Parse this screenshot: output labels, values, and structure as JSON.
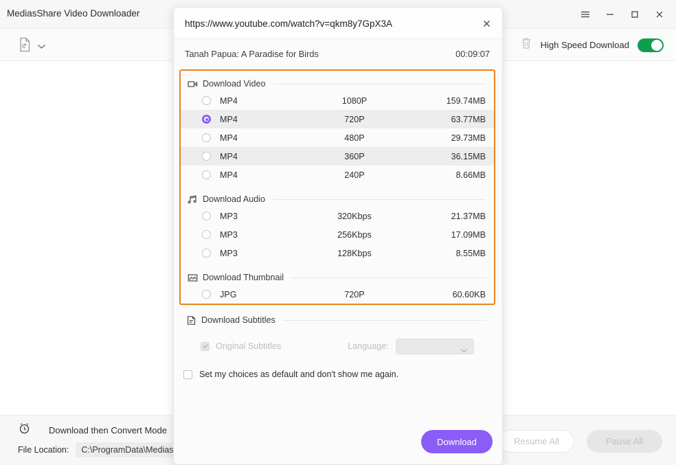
{
  "window": {
    "title": "MediasShare Video Downloader",
    "controls": [
      {
        "name": "menu",
        "label": "☰"
      },
      {
        "name": "minimize",
        "label": "–"
      },
      {
        "name": "maximize",
        "label": "□"
      },
      {
        "name": "close",
        "label": "✕"
      }
    ]
  },
  "toolbar": {
    "add_file_icon": "file-add-icon",
    "dropdown_caret": "chevron-down-icon",
    "trash_icon": "trash-icon",
    "high_speed_label": "High Speed Download",
    "high_speed_enabled": true,
    "accent_green": "#0f9e4e"
  },
  "footer": {
    "convert_mode_label": "Download then Convert Mode",
    "convert_mode_enabled": false,
    "clock_icon": "alarm-clock-icon",
    "file_location_label": "File Location:",
    "file_location_value": "C:\\ProgramData\\MediasS",
    "resume_all_label": "Resume All",
    "pause_all_label": "Pause All"
  },
  "dialog": {
    "url": "https://www.youtube.com/watch?v=qkm8y7GpX3A",
    "close_icon": "close-icon",
    "video_title": "Tanah Papua:  A Paradise for Birds",
    "duration": "00:09:07",
    "highlight_color": "#e8841c",
    "accent_purple": "#8b5cf6",
    "sections": [
      {
        "name": "download-video",
        "icon": "video-camera-icon",
        "title": "Download Video",
        "options": [
          {
            "format": "MP4",
            "quality": "1080P",
            "size": "159.74MB",
            "selected": false,
            "shaded": false
          },
          {
            "format": "MP4",
            "quality": "720P",
            "size": "63.77MB",
            "selected": true,
            "shaded": true
          },
          {
            "format": "MP4",
            "quality": "480P",
            "size": "29.73MB",
            "selected": false,
            "shaded": false
          },
          {
            "format": "MP4",
            "quality": "360P",
            "size": "36.15MB",
            "selected": false,
            "shaded": true
          },
          {
            "format": "MP4",
            "quality": "240P",
            "size": "8.66MB",
            "selected": false,
            "shaded": false
          }
        ]
      },
      {
        "name": "download-audio",
        "icon": "music-note-icon",
        "title": "Download Audio",
        "options": [
          {
            "format": "MP3",
            "quality": "320Kbps",
            "size": "21.37MB",
            "selected": false,
            "shaded": false
          },
          {
            "format": "MP3",
            "quality": "256Kbps",
            "size": "17.09MB",
            "selected": false,
            "shaded": false
          },
          {
            "format": "MP3",
            "quality": "128Kbps",
            "size": "8.55MB",
            "selected": false,
            "shaded": false
          }
        ]
      },
      {
        "name": "download-thumbnail",
        "icon": "image-icon",
        "title": "Download Thumbnail",
        "options": [
          {
            "format": "JPG",
            "quality": "720P",
            "size": "60.60KB",
            "selected": false,
            "shaded": false
          }
        ]
      }
    ],
    "subtitles": {
      "icon": "document-icon",
      "title": "Download Subtitles",
      "original_label": "Original Subtitles",
      "original_checked": true,
      "original_disabled": true,
      "language_label": "Language:",
      "language_value": "",
      "language_caret": "chevron-down-icon"
    },
    "default_checkbox": {
      "label": "Set my choices as default and don't show me again.",
      "checked": false
    },
    "download_button": "Download"
  }
}
